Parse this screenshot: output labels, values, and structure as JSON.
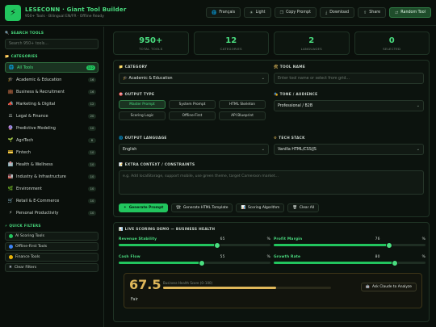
{
  "header": {
    "logo_glyph": "⚡",
    "title": "LESECONN · Giant Tool Builder",
    "subtitle": "950+ Tools · Bilingual EN/FR · Offline Ready",
    "buttons": [
      {
        "icon": "globe-icon",
        "glyph": "🌐",
        "label": "Français"
      },
      {
        "icon": "sun-icon",
        "glyph": "☀",
        "label": "Light"
      },
      {
        "icon": "copy-icon",
        "glyph": "❐",
        "label": "Copy Prompt"
      },
      {
        "icon": "download-icon",
        "glyph": "⤓",
        "label": "Download"
      },
      {
        "icon": "share-icon",
        "glyph": "⇪",
        "label": "Share"
      },
      {
        "icon": "shuffle-icon",
        "glyph": "⇄",
        "label": "Random Tool"
      }
    ]
  },
  "sidebar": {
    "search_title": "SEARCH TOOLS",
    "search_placeholder": "Search 950+ tools...",
    "categories_title": "CATEGORIES",
    "categories": [
      {
        "icon": "globe-icon",
        "glyph": "🌐",
        "label": "All Tools",
        "count": "112"
      },
      {
        "icon": "graduation-cap-icon",
        "glyph": "🎓",
        "label": "Academic & Education",
        "count": "16"
      },
      {
        "icon": "briefcase-icon",
        "glyph": "💼",
        "label": "Business & Recruitment",
        "count": "16"
      },
      {
        "icon": "megaphone-icon",
        "glyph": "📣",
        "label": "Marketing & Digital",
        "count": "12"
      },
      {
        "icon": "scales-icon",
        "glyph": "⚖",
        "label": "Legal & Finance",
        "count": "20"
      },
      {
        "icon": "crystal-ball-icon",
        "glyph": "🔮",
        "label": "Predictive Modeling",
        "count": "10"
      },
      {
        "icon": "seedling-icon",
        "glyph": "🌱",
        "label": "AgriTech",
        "count": "8"
      },
      {
        "icon": "card-icon",
        "glyph": "💳",
        "label": "Fintech",
        "count": "10"
      },
      {
        "icon": "hospital-icon",
        "glyph": "🏥",
        "label": "Health & Wellness",
        "count": "10"
      },
      {
        "icon": "factory-icon",
        "glyph": "🏭",
        "label": "Industry & Infrastructure",
        "count": "10"
      },
      {
        "icon": "leaf-icon",
        "glyph": "🌿",
        "label": "Environment",
        "count": "10"
      },
      {
        "icon": "cart-icon",
        "glyph": "🛒",
        "label": "Retail & E-Commerce",
        "count": "10"
      },
      {
        "icon": "bolt-icon",
        "glyph": "⚡",
        "label": "Personal Productivity",
        "count": "10"
      }
    ],
    "quick_title": "QUICK FILTERS",
    "quick_filters": [
      {
        "label": "AI Scoring Tools",
        "color": "#22c55e"
      },
      {
        "label": "Offline-First Tools",
        "color": "#3b82f6"
      },
      {
        "label": "Finance Tools",
        "color": "#eab308"
      },
      {
        "label": "Clear Filters",
        "color": "#9ca3af",
        "glyph": "✖"
      }
    ]
  },
  "stats": [
    {
      "value": "950+",
      "label": "TOTAL TOOLS"
    },
    {
      "value": "12",
      "label": "CATEGORIES"
    },
    {
      "value": "2",
      "label": "LANGUAGES"
    },
    {
      "value": "0",
      "label": "SELECTED"
    }
  ],
  "builder": {
    "category_label": "CATEGORY",
    "category_value": "🎓 Academic & Education",
    "tool_name_label": "TOOL NAME",
    "tool_name_placeholder": "Enter tool name or select from grid...",
    "output_type_label": "OUTPUT TYPE",
    "output_types": [
      "Master Prompt",
      "System Prompt",
      "HTML Skeleton",
      "Scoring Logic",
      "Offline-First",
      "API Blueprint"
    ],
    "tone_label": "TONE / AUDIENCE",
    "tone_value": "Professional / B2B",
    "output_language_label": "OUTPUT LANGUAGE",
    "output_language_value": "English",
    "tech_stack_label": "TECH STACK",
    "tech_stack_value": "Vanilla HTML/CSS/JS",
    "extra_label": "EXTRA CONTEXT / CONSTRAINTS",
    "extra_placeholder": "e.g. Add localStorage, support mobile, use green theme, target Cameroon market...",
    "actions": [
      {
        "icon": "sparkle-icon",
        "glyph": "✦",
        "label": "Generate Prompt"
      },
      {
        "icon": "template-icon",
        "glyph": "🏗",
        "label": "Generate HTML Template"
      },
      {
        "icon": "chart-icon",
        "glyph": "📊",
        "label": "Scoring Algorithm"
      },
      {
        "icon": "trash-icon",
        "glyph": "🗑",
        "label": "Clear All"
      }
    ]
  },
  "scoring": {
    "title": "LIVE SCORING DEMO — BUSINESS HEALTH",
    "sliders": [
      {
        "label": "Revenue Stability",
        "value": "65",
        "unit": "%",
        "fraction": 0.65
      },
      {
        "label": "Profit Margin",
        "value": "76",
        "unit": "%",
        "fraction": 0.76
      },
      {
        "label": "Cash Flow",
        "value": "55",
        "unit": "%",
        "fraction": 0.55
      },
      {
        "label": "Growth Rate",
        "value": "80",
        "unit": "%",
        "fraction": 0.8
      }
    ],
    "score": "67.5",
    "grade": "Fair",
    "score_label": "Business Health Score (0–100)",
    "score_fraction": 0.675,
    "ask_label": "Ask Claude to Analyze"
  }
}
